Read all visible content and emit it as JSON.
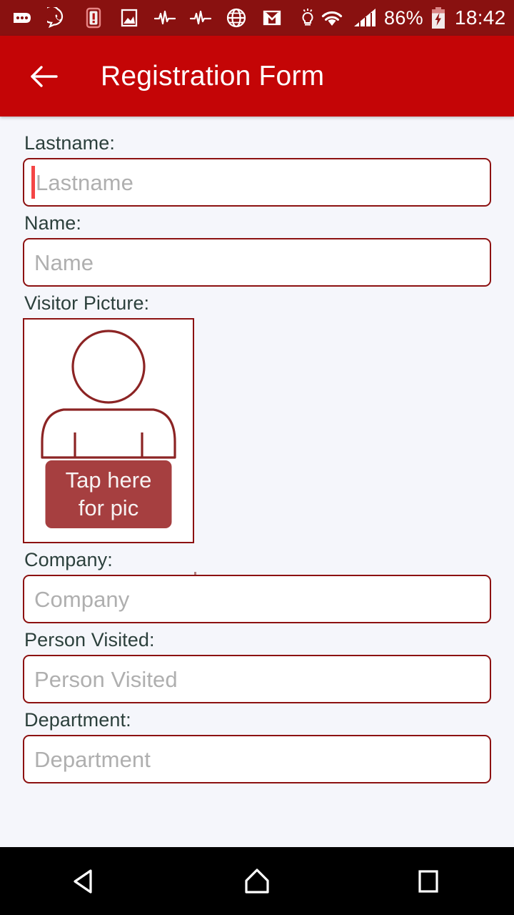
{
  "status_bar": {
    "background_color": "#891110",
    "left_icons": [
      {
        "name": "messages-icon",
        "glyph": "speech-bubble-dots"
      },
      {
        "name": "whatsapp-icon",
        "glyph": "whatsapp"
      },
      {
        "name": "alert-icon",
        "glyph": "exclamation-box"
      },
      {
        "name": "image-icon",
        "glyph": "picture"
      },
      {
        "name": "pulse-icon-1",
        "glyph": "heartbeat"
      },
      {
        "name": "pulse-icon-2",
        "glyph": "heartbeat"
      },
      {
        "name": "browser-icon",
        "glyph": "globe"
      },
      {
        "name": "gmail-icon",
        "glyph": "gmail-m"
      },
      {
        "name": "idea-icon",
        "glyph": "lightbulb"
      }
    ],
    "wifi_icon": "wifi-icon",
    "signal_icon": "cellular-signal-icon",
    "battery_percent": "86%",
    "battery_icon": "battery-charging-icon",
    "clock": "18:42"
  },
  "app_bar": {
    "background_color": "#C40506",
    "back_icon": "arrow-back-icon",
    "title": "Registration Form",
    "title_color": "#FFFFFF"
  },
  "form": {
    "background_color": "#F5F6FB",
    "label_color": "#2C403C",
    "input_border_color": "#8C1111",
    "placeholder_color": "#AFAFAF",
    "caret_color": "#F44545",
    "fields": [
      {
        "label": "Lastname:",
        "placeholder": "Lastname",
        "value": "",
        "focused": true
      },
      {
        "label": "Name:",
        "placeholder": "Name",
        "value": "",
        "focused": false
      },
      {
        "label": "Company:",
        "placeholder": "Company",
        "value": "",
        "focused": false
      },
      {
        "label": "Person Visited:",
        "placeholder": "Person Visited",
        "value": "",
        "focused": false
      },
      {
        "label": "Department:",
        "placeholder": "Department",
        "value": "",
        "focused": false
      }
    ],
    "picture": {
      "label": "Visitor Picture:",
      "avatar_icon": "person-placeholder-icon",
      "avatar_stroke_color": "#8C2424",
      "button_line1": "Tap here",
      "button_line2": "for pic",
      "button_color": "#A63F40",
      "button_text_color": "#F7F2F2"
    }
  },
  "nav_bar": {
    "background_color": "#000000",
    "back_label": "back-triangle-icon",
    "home_label": "home-pentagon-icon",
    "recents_label": "recents-square-icon"
  }
}
